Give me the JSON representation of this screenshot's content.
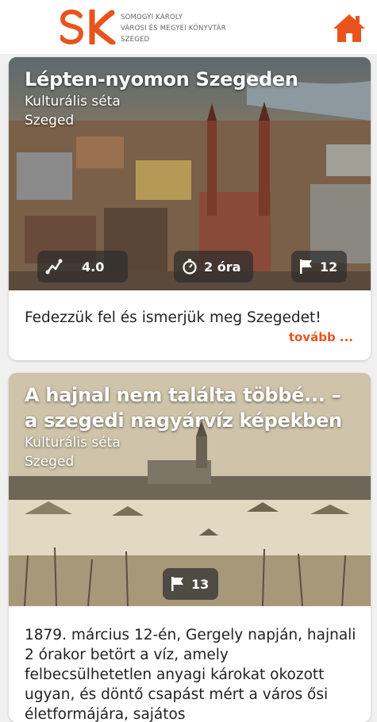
{
  "header": {
    "logo_mark": "SK",
    "library_name_lines": [
      "SOMOGYI KÁROLY",
      "VÁROSI ÉS MEGYEI KÖNYVTÁR",
      "SZEGED"
    ],
    "home_icon": "home-icon"
  },
  "colors": {
    "accent": "#e8541e",
    "card_bg": "#ffffff",
    "page_bg": "#f0f0f0"
  },
  "tours": [
    {
      "title": "Lépten-nyomon Szegeden",
      "category": "Kulturális séta",
      "city": "Szeged",
      "difficulty": "4.0",
      "duration": "2 óra",
      "stations": "12",
      "description": "Fedezzük fel és ismerjük meg Szegedet!",
      "more_label": "tovább ..."
    },
    {
      "title": "A hajnal nem találta többé... – a szegedi nagyárvíz képekben",
      "category": "Kulturális séta",
      "city": "Szeged",
      "stations": "13",
      "description": "1879. március 12-én, Gergely napján, hajnali 2 órakor betört a víz, amely felbecsülhetetlen anyagi károkat okozott ugyan, és döntő csapást mért a város ősi életformájára, sajátos"
    }
  ]
}
